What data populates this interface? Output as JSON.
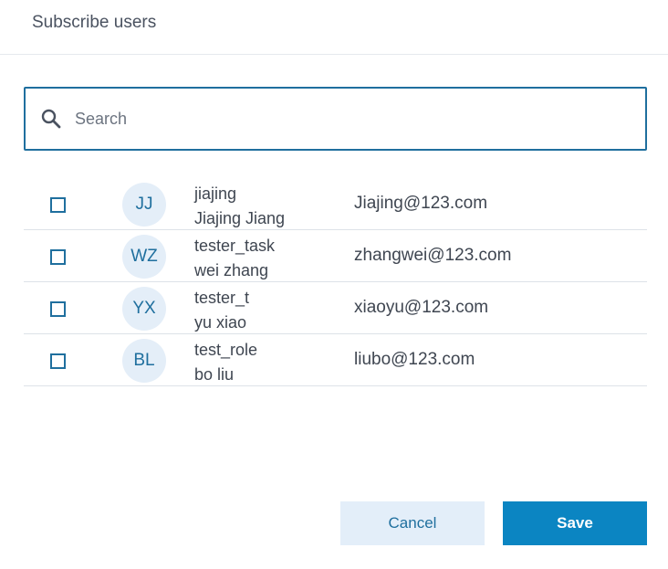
{
  "dialog": {
    "title": "Subscribe users"
  },
  "search": {
    "placeholder": "Search",
    "value": "",
    "icon": "search-icon"
  },
  "users": [
    {
      "initials": "JJ",
      "username": "jiajing",
      "full_name": "Jiajing Jiang",
      "email": "Jiajing@123.com",
      "checked": false
    },
    {
      "initials": "WZ",
      "username": "tester_task",
      "full_name": "wei zhang",
      "email": "zhangwei@123.com",
      "checked": false
    },
    {
      "initials": "YX",
      "username": "tester_t",
      "full_name": "yu xiao",
      "email": "xiaoyu@123.com",
      "checked": false
    },
    {
      "initials": "BL",
      "username": "test_role",
      "full_name": "bo liu",
      "email": "liubo@123.com",
      "checked": false
    }
  ],
  "actions": {
    "cancel_label": "Cancel",
    "save_label": "Save"
  },
  "colors": {
    "accent": "#1f6f9e",
    "primary_button": "#0b85c2",
    "secondary_button": "#e3eef9",
    "avatar_bg": "#e4eef8"
  }
}
